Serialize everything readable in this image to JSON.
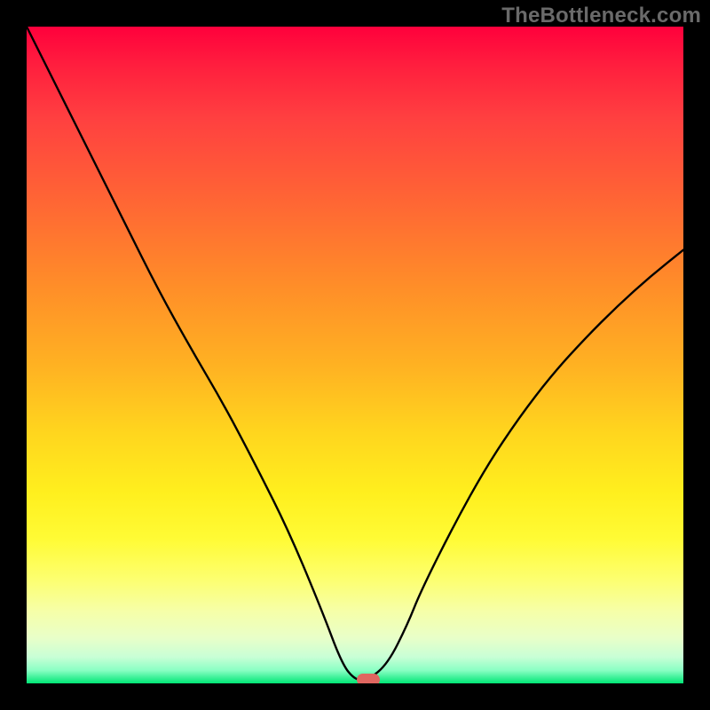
{
  "watermark": "TheBottleneck.com",
  "chart_data": {
    "type": "line",
    "title": "",
    "xlabel": "",
    "ylabel": "",
    "xlim": [
      0,
      100
    ],
    "ylim": [
      0,
      100
    ],
    "grid": false,
    "legend": false,
    "x": [
      0,
      5,
      10,
      15,
      20,
      25,
      30,
      35,
      40,
      45,
      48,
      50,
      52,
      55,
      58,
      60,
      65,
      70,
      75,
      80,
      85,
      90,
      95,
      100
    ],
    "values": [
      100,
      90,
      80,
      70,
      60,
      51,
      42.5,
      33,
      23,
      11,
      3,
      0.5,
      0.5,
      3,
      9,
      14,
      24,
      33,
      40.5,
      47,
      52.5,
      57.5,
      62,
      66
    ],
    "marker": {
      "x": 52,
      "y": 0.5,
      "color": "#e06660"
    },
    "background_gradient": {
      "stops": [
        {
          "pos": 0.0,
          "color": "#ff003c"
        },
        {
          "pos": 0.5,
          "color": "#ffb322"
        },
        {
          "pos": 0.8,
          "color": "#fffb35"
        },
        {
          "pos": 1.0,
          "color": "#00e676"
        }
      ]
    }
  }
}
